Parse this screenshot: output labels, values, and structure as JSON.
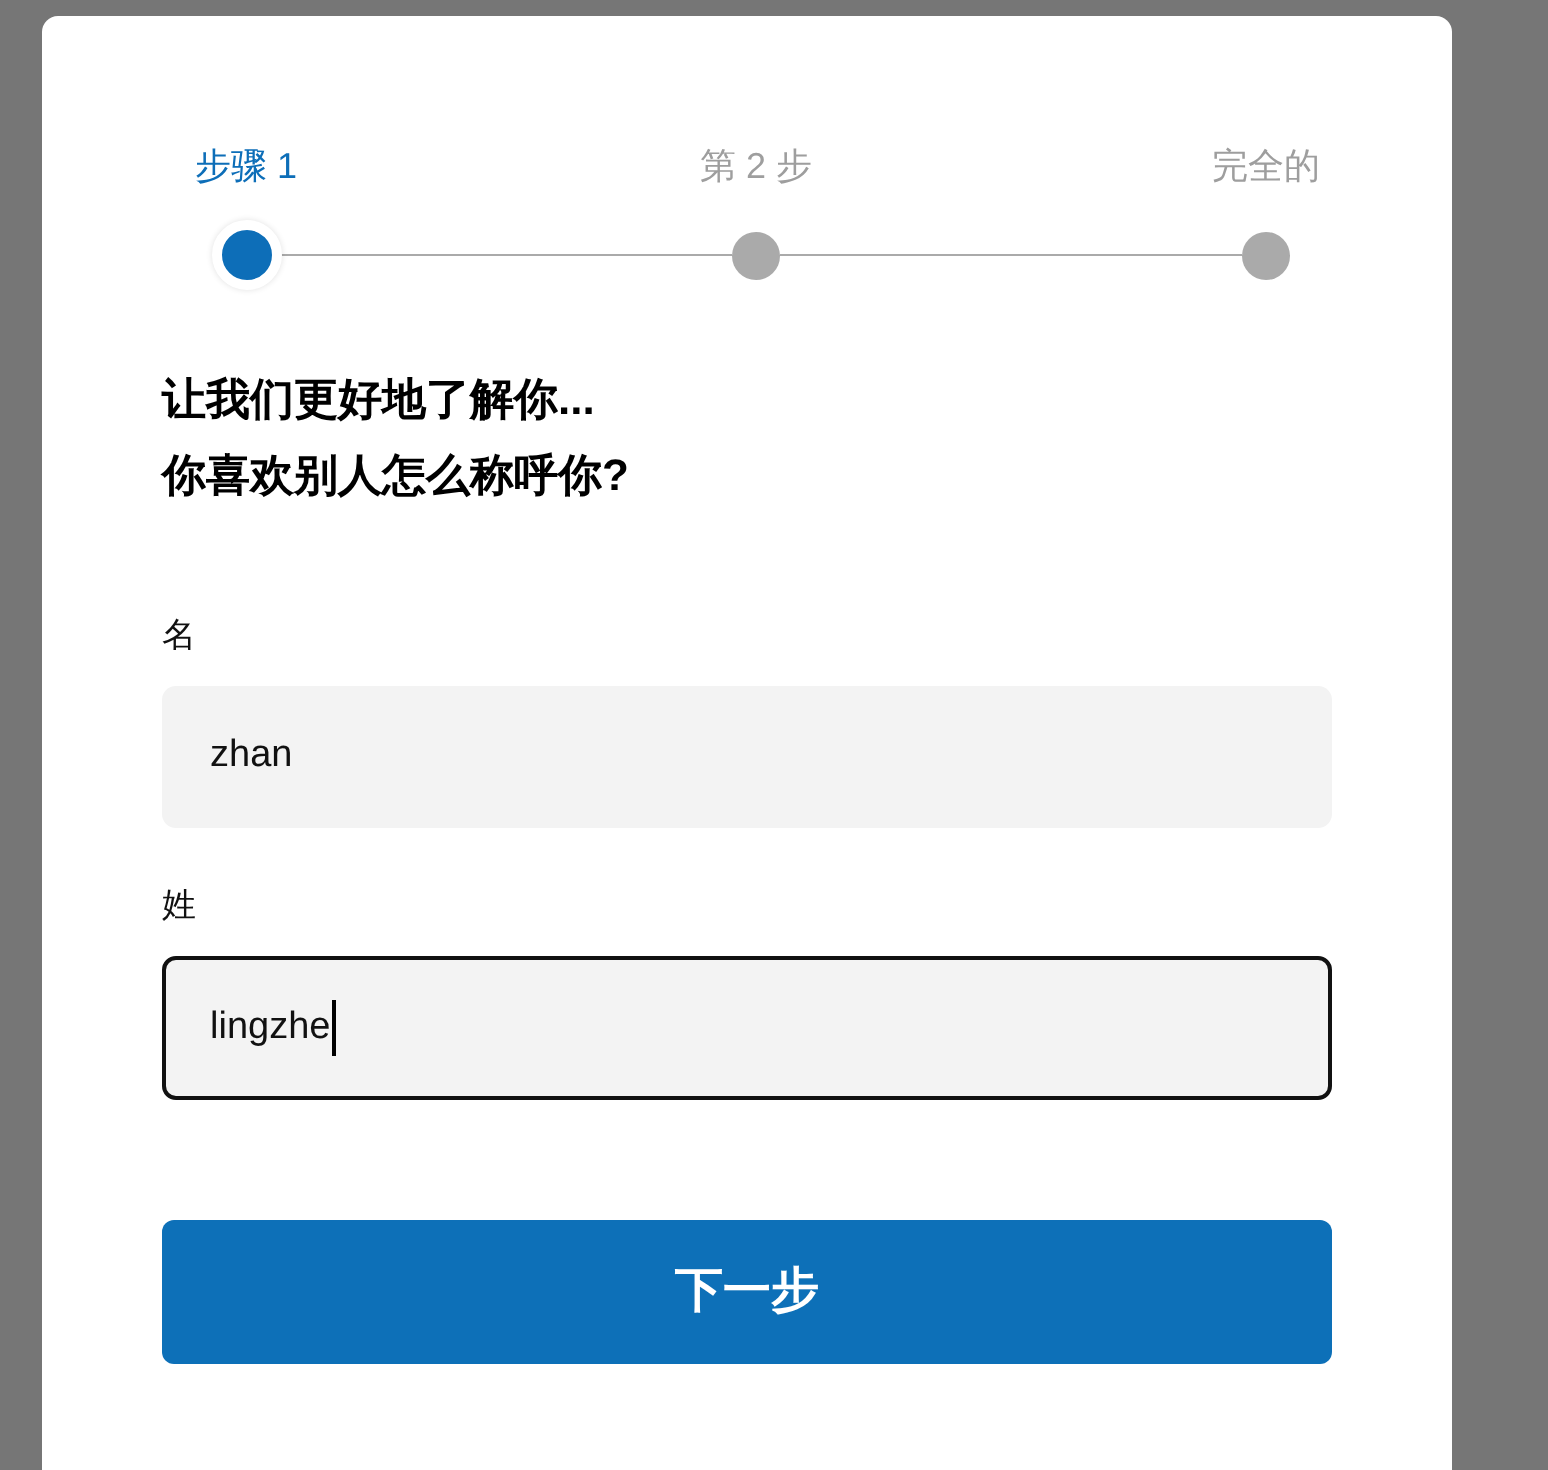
{
  "stepper": {
    "steps": [
      {
        "label": "步骤 1",
        "selected": true
      },
      {
        "label": "第 2 步",
        "selected": false
      },
      {
        "label": "完全的",
        "selected": false
      }
    ]
  },
  "heading": {
    "lines": [
      "让我们更好地了解你...",
      "你喜欢别人怎么称呼你?"
    ]
  },
  "fields": [
    {
      "label": "名",
      "value": "zhan",
      "focused": false
    },
    {
      "label": "姓",
      "value": "lingzhe",
      "focused": true
    }
  ],
  "button": {
    "label": "下一步"
  }
}
